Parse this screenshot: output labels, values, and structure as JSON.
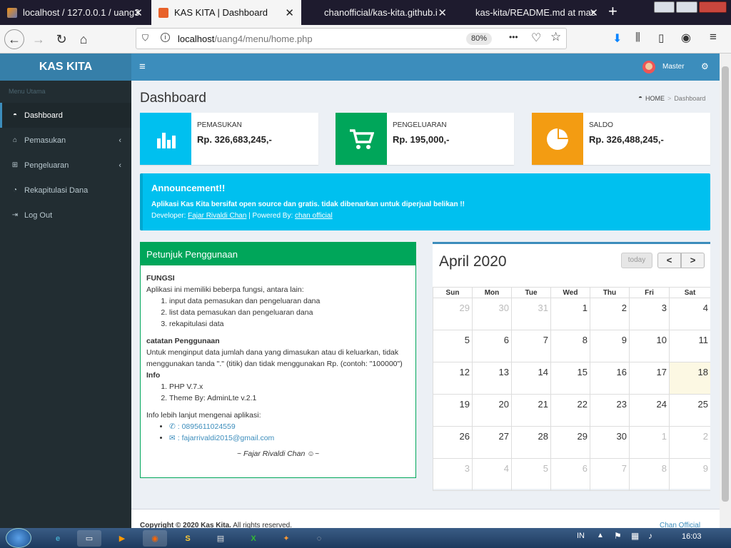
{
  "browser": {
    "tabs": [
      {
        "title": "localhost / 127.0.0.1 / uang3",
        "active": false
      },
      {
        "title": "KAS KITA | Dashboard",
        "active": true
      },
      {
        "title": "chanofficial/kas-kita.github.i",
        "active": false
      },
      {
        "title": "kas-kita/README.md at mas",
        "active": false
      }
    ],
    "url_host": "localhost",
    "url_path": "/uang4/menu/home.php",
    "zoom": "80%",
    "new_tab": "+",
    "close_glyph": "✕",
    "more_glyph": "•••"
  },
  "app": {
    "brand": "KAS KITA",
    "user": "Master",
    "menu_header": "Menu Utama",
    "menu": [
      {
        "label": "Dashboard",
        "icon": "dashboard-icon",
        "glyph": "◓",
        "active": true,
        "chevron": false
      },
      {
        "label": "Pemasukan",
        "icon": "bank-icon",
        "glyph": "⌂",
        "active": false,
        "chevron": true
      },
      {
        "label": "Pengeluaran",
        "icon": "cart-icon",
        "glyph": "⊞",
        "active": false,
        "chevron": true
      },
      {
        "label": "Rekapitulasi Dana",
        "icon": "pie-chart-icon",
        "glyph": "◔",
        "active": false,
        "chevron": false
      },
      {
        "label": "Log Out",
        "icon": "sign-out-icon",
        "glyph": "⇥",
        "active": false,
        "chevron": false
      }
    ],
    "page_title": "Dashboard",
    "breadcrumb": {
      "home": "HOME",
      "sep": ">",
      "current": "Dashboard"
    },
    "stats": [
      {
        "label": "PEMASUKAN",
        "value": "Rp. 326,683,245,-",
        "color": "#00c0ef",
        "icon": "bar-chart-icon"
      },
      {
        "label": "PENGELUARAN",
        "value": "Rp. 195,000,-",
        "color": "#00a65a",
        "icon": "cart-icon"
      },
      {
        "label": "SALDO",
        "value": "Rp. 326,488,245,-",
        "color": "#f39c12",
        "icon": "pie-chart-icon"
      }
    ],
    "announcement": {
      "title": "Announcement!!",
      "text": "Aplikasi Kas Kita bersifat open source dan gratis. tidak dibenarkan untuk diperjual belikan !!",
      "dev_prefix": "Developer: ",
      "dev_name": "Fajar Rivaldi Chan",
      "powered_prefix": " | Powered By: ",
      "powered_name": "chan official"
    },
    "guide": {
      "title": "Petunjuk Penggunaan",
      "fungsi_title": "FUNGSI",
      "fungsi_intro": "Aplikasi ini memiliki beberpa fungsi, antara lain:",
      "fungsi_items": [
        "input data pemasukan dan pengeluaran dana",
        "list data pemasukan dan pengeluaran dana",
        "rekapitulasi data"
      ],
      "catatan_title": "catatan Penggunaan",
      "catatan_text": "Untuk menginput data jumlah dana yang dimasukan atau di keluarkan, tidak menggunakan tanda \".\" (titik) dan tidak menggunakan Rp. (contoh: \"100000\")",
      "info_title": "Info",
      "info_items": [
        "PHP V.7.x",
        "Theme By: AdminLte v.2.1"
      ],
      "contact_intro": "Info lebih lanjut mengenai aplikasi:",
      "phone": ": 0895611024559",
      "email": ": fajarrivaldi2015@gmail.com",
      "signature": "~ Fajar Rivaldi Chan ☺~"
    },
    "calendar": {
      "title": "April 2020",
      "today_label": "today",
      "prev": "<",
      "next": ">",
      "days": [
        "Sun",
        "Mon",
        "Tue",
        "Wed",
        "Thu",
        "Fri",
        "Sat"
      ],
      "weeks": [
        [
          {
            "d": "29",
            "m": true
          },
          {
            "d": "30",
            "m": true
          },
          {
            "d": "31",
            "m": true
          },
          {
            "d": "1"
          },
          {
            "d": "2"
          },
          {
            "d": "3"
          },
          {
            "d": "4"
          }
        ],
        [
          {
            "d": "5"
          },
          {
            "d": "6"
          },
          {
            "d": "7"
          },
          {
            "d": "8"
          },
          {
            "d": "9"
          },
          {
            "d": "10"
          },
          {
            "d": "11"
          }
        ],
        [
          {
            "d": "12"
          },
          {
            "d": "13"
          },
          {
            "d": "14"
          },
          {
            "d": "15"
          },
          {
            "d": "16"
          },
          {
            "d": "17"
          },
          {
            "d": "18",
            "t": true
          }
        ],
        [
          {
            "d": "19"
          },
          {
            "d": "20"
          },
          {
            "d": "21"
          },
          {
            "d": "22"
          },
          {
            "d": "23"
          },
          {
            "d": "24"
          },
          {
            "d": "25"
          }
        ],
        [
          {
            "d": "26"
          },
          {
            "d": "27"
          },
          {
            "d": "28"
          },
          {
            "d": "29"
          },
          {
            "d": "30"
          },
          {
            "d": "1",
            "m": true
          },
          {
            "d": "2",
            "m": true
          }
        ],
        [
          {
            "d": "3",
            "m": true
          },
          {
            "d": "4",
            "m": true
          },
          {
            "d": "5",
            "m": true
          },
          {
            "d": "6",
            "m": true
          },
          {
            "d": "7",
            "m": true
          },
          {
            "d": "8",
            "m": true
          },
          {
            "d": "9",
            "m": true
          }
        ]
      ]
    },
    "footer": {
      "copyright_bold": "Copyright © 2020 Kas Kita.",
      "copyright_rest": " All rights reserved.",
      "right": "Chan Official"
    }
  },
  "taskbar": {
    "lang": "IN",
    "time": "16:03"
  }
}
